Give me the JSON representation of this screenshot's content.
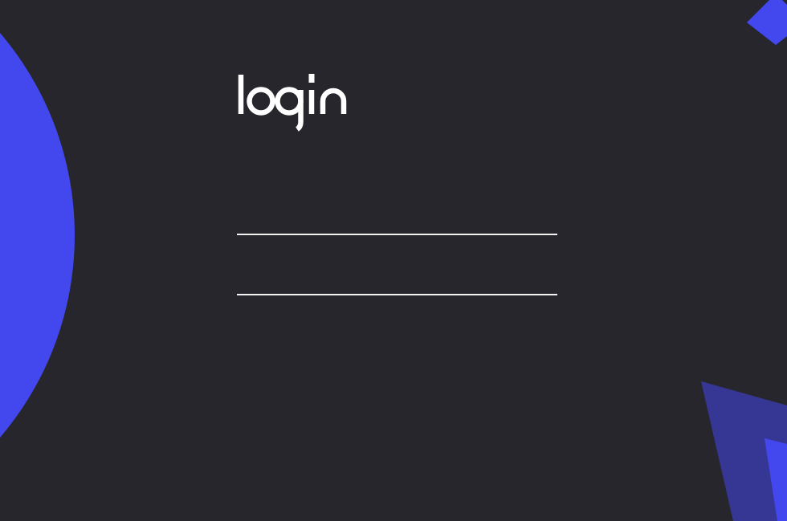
{
  "colors": {
    "background": "#27262c",
    "accent": "#4348ee",
    "accent_dim": "#363795",
    "foreground": "#ffffff"
  },
  "logo": {
    "text": "login"
  },
  "form": {
    "username": {
      "value": "",
      "placeholder": ""
    },
    "password": {
      "value": "",
      "placeholder": ""
    }
  }
}
